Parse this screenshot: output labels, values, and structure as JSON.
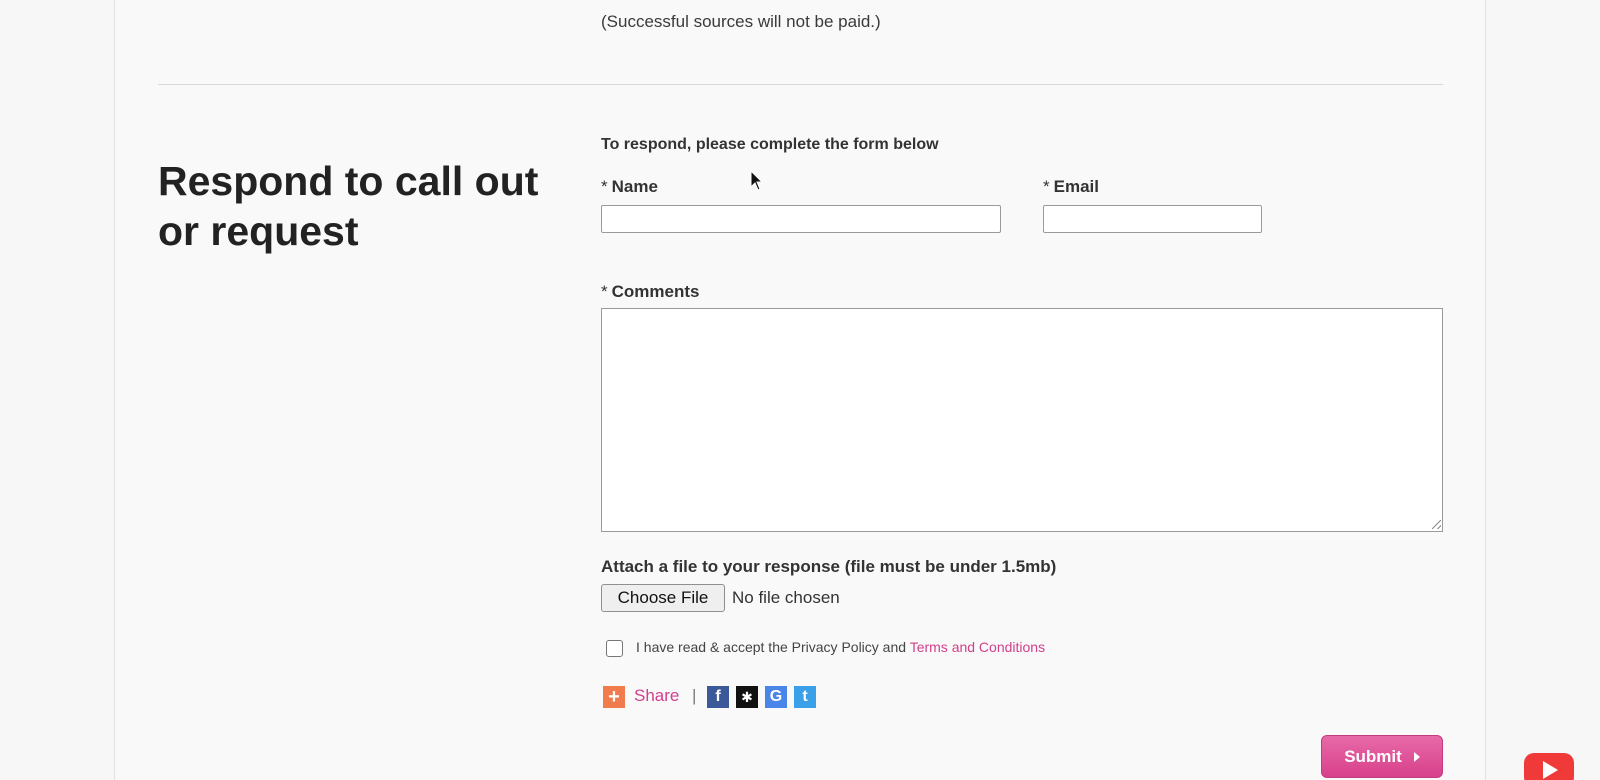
{
  "note": "(Successful sources will not be paid.)",
  "section": {
    "heading_line1": "Respond to call out",
    "heading_line2": "or request"
  },
  "form": {
    "intro": "To respond, please complete the form below",
    "required_marker": "*",
    "name_label": "Name",
    "name_value": "",
    "email_label": "Email",
    "email_value": "",
    "comments_label": "Comments",
    "comments_value": "",
    "attach_label": "Attach a file to your response (file must be under 1.5mb)",
    "choose_file_label": "Choose File",
    "file_status": "No file chosen",
    "accept_text": "I have read & accept the Privacy Policy and",
    "accept_link": "Terms and Conditions",
    "accept_checked": false,
    "submit_label": "Submit"
  },
  "share": {
    "icon": "plus-icon",
    "label": "Share",
    "separator": "|",
    "networks": [
      {
        "name": "facebook",
        "glyph": "f",
        "color": "#3b5998"
      },
      {
        "name": "myspace",
        "glyph": "✱",
        "color": "#111111"
      },
      {
        "name": "google",
        "glyph": "G",
        "color": "#4a86e8"
      },
      {
        "name": "twitter",
        "glyph": "t",
        "color": "#3aa0e8"
      }
    ]
  },
  "colors": {
    "accent_pink": "#d23f8c",
    "share_orange": "#f07c4e"
  }
}
